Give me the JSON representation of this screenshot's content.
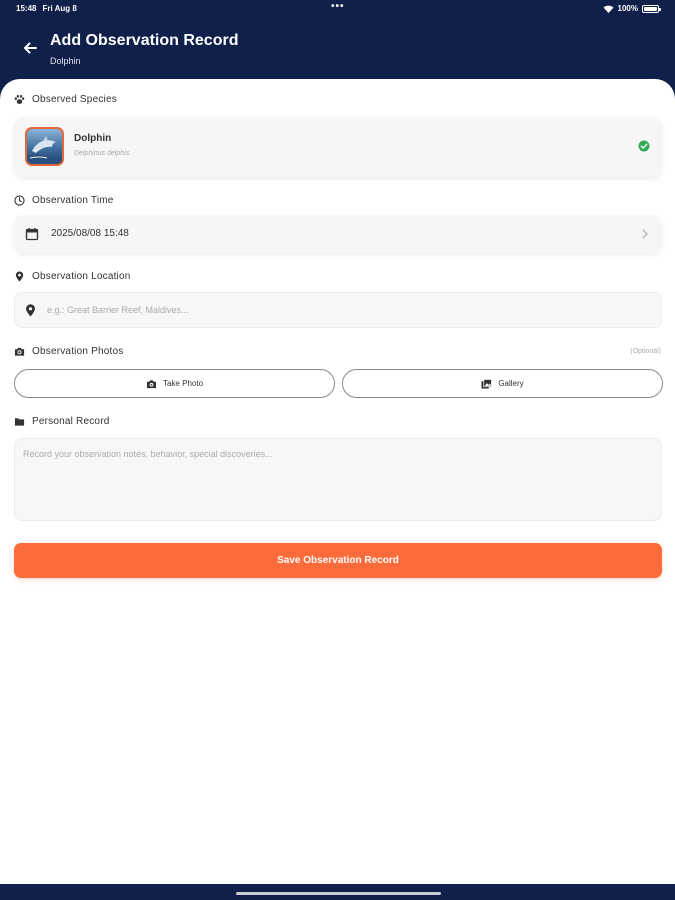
{
  "status_bar": {
    "time": "15:48",
    "date": "Fri Aug 8",
    "battery": "100%",
    "battery_level": 1.0
  },
  "header": {
    "title": "Add Observation Record",
    "subtitle": "Dolphin",
    "back_icon": "arrow-left-icon"
  },
  "species": {
    "label": "Observed Species",
    "label_icon": "paw-icon",
    "name": "Dolphin",
    "scientific_name": "Delphinus delphis",
    "selected": true,
    "check_color": "#34a853"
  },
  "time": {
    "label": "Observation Time",
    "label_icon": "clock-icon",
    "value": "2025/08/08 15:48"
  },
  "location": {
    "label": "Observation Location",
    "label_icon": "location-pin-icon",
    "placeholder": "e.g.: Great Barrier Reef, Maldives...",
    "value": ""
  },
  "photos": {
    "label": "Observation Photos",
    "label_icon": "camera-icon",
    "optional_label": "(Optional)",
    "take_photo_label": "Take Photo",
    "gallery_label": "Gallery"
  },
  "notes": {
    "label": "Personal Record",
    "label_icon": "folder-icon",
    "placeholder": "Record your observation notes, behavior, special discoveries...",
    "value": ""
  },
  "save_label": "Save Observation Record",
  "colors": {
    "header_bg": "#10204a",
    "accent": "#fd6b3b",
    "thumb_border": "#e4663b"
  }
}
